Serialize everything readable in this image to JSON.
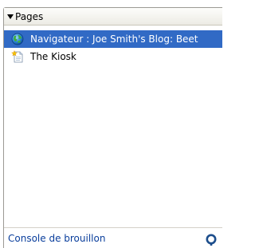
{
  "header": {
    "title": "Pages",
    "toggle_icon": "triangle-down-icon"
  },
  "pages": [
    {
      "label": "Navigateur : Joe Smith's Blog: Beet",
      "icon": "globe-icon",
      "selected": true
    },
    {
      "label": "The Kiosk",
      "icon": "new-page-icon",
      "selected": false
    }
  ],
  "footer": {
    "link_label": "Console de brouillon",
    "icon": "refresh-icon"
  },
  "colors": {
    "selection": "#316ac5",
    "link": "#0a3e9c",
    "border": "#9c9a94"
  }
}
